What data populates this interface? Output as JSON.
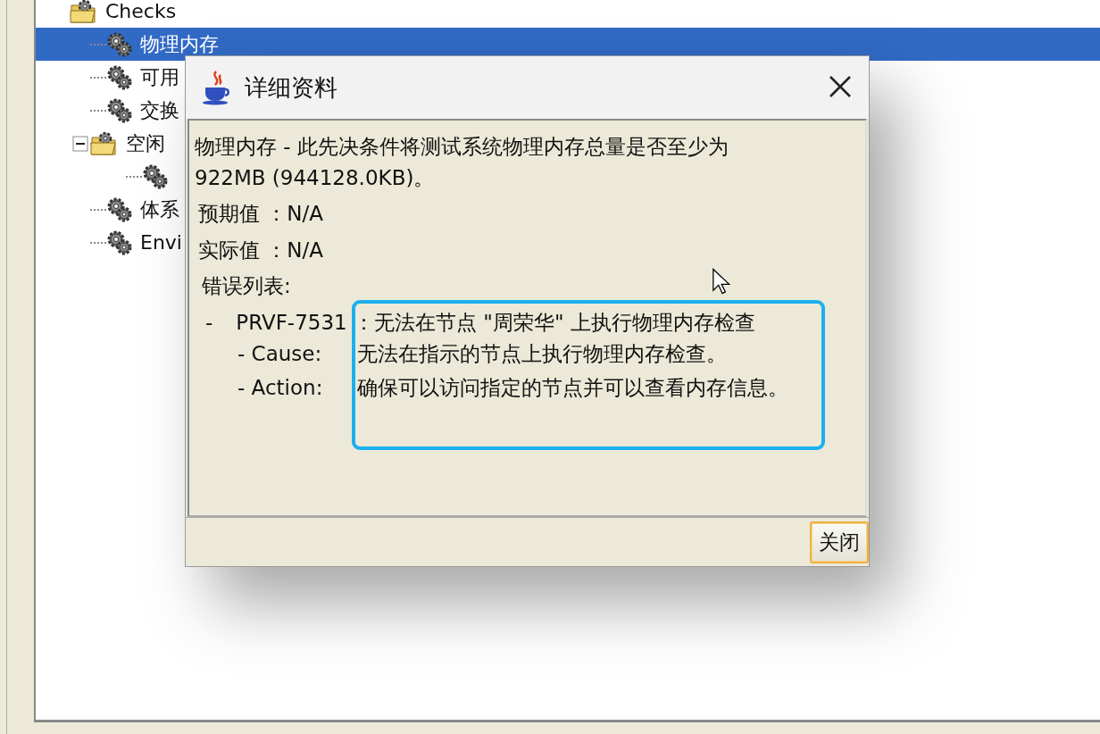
{
  "tree": {
    "items": [
      {
        "label": "Checks",
        "kind": "folder",
        "selected": false,
        "children": [
          {
            "label": "物理内存",
            "kind": "gear",
            "selected": true
          },
          {
            "label": "可用",
            "kind": "gear",
            "selected": false
          },
          {
            "label": "交换",
            "kind": "gear",
            "selected": false
          },
          {
            "label": "空闲",
            "kind": "folder",
            "selected": false,
            "expanded": true,
            "children": [
              {
                "kind": "gear",
                "selected": false
              }
            ]
          },
          {
            "label": "体系",
            "kind": "gear",
            "selected": false
          },
          {
            "label": "Envi",
            "kind": "gear",
            "selected": false
          }
        ]
      }
    ]
  },
  "dialog": {
    "title": "详细资料",
    "description": "物理内存 - 此先决条件将测试系统物理内存总量是否至少为 922MB (944128.0KB)。",
    "fields": [
      {
        "label": "预期值",
        "separator": "：",
        "value": "N/A"
      },
      {
        "label": "实际值",
        "separator": "：",
        "value": "N/A"
      }
    ],
    "errors_heading": "错误列表:",
    "errors": [
      {
        "bullet": "-",
        "code": "PRVF-7531",
        "message": "：无法在节点 \"周荣华\" 上执行物理内存检查",
        "details": [
          {
            "label": "- Cause:",
            "text": "无法在指示的节点上执行物理内存检查。"
          },
          {
            "label": "- Action:",
            "text": "确保可以访问指定的节点并可以查看内存信息。"
          }
        ]
      }
    ],
    "buttons": [
      {
        "label": "关闭",
        "selected": true
      }
    ]
  }
}
